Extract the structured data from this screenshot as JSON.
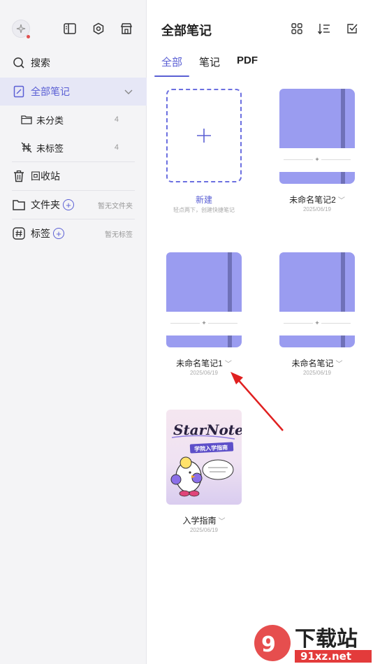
{
  "sidebar": {
    "search_label": "搜索",
    "all_notes_label": "全部笔记",
    "uncategorized_label": "未分类",
    "uncategorized_count": "4",
    "untagged_label": "未标签",
    "untagged_count": "4",
    "recycle_label": "回收站",
    "folders_label": "文件夹",
    "folders_hint": "暂无文件夹",
    "tags_label": "标签",
    "tags_hint": "暂无标签"
  },
  "main": {
    "title": "全部笔记",
    "tabs": [
      {
        "label": "全部"
      },
      {
        "label": "笔记"
      },
      {
        "label": "PDF"
      }
    ],
    "new_card": {
      "title": "新建",
      "hint": "轻点两下，创建快捷笔记"
    },
    "notes": [
      {
        "title": "未命名笔记2",
        "date": "2025/06/19"
      },
      {
        "title": "未命名笔记1",
        "date": "2025/06/19"
      },
      {
        "title": "未命名笔记",
        "date": "2025/06/19"
      },
      {
        "title": "入学指南",
        "date": "2025/06/19"
      }
    ],
    "guide_cover": {
      "brand": "StarNote",
      "subtitle": "学院入学指南"
    }
  },
  "watermark": {
    "text_cn": "下载站",
    "text_url": "91xz.net"
  },
  "colors": {
    "accent": "#5a5fd4",
    "notebook": "#9a9cf0",
    "annotation_arrow": "#e02020"
  }
}
